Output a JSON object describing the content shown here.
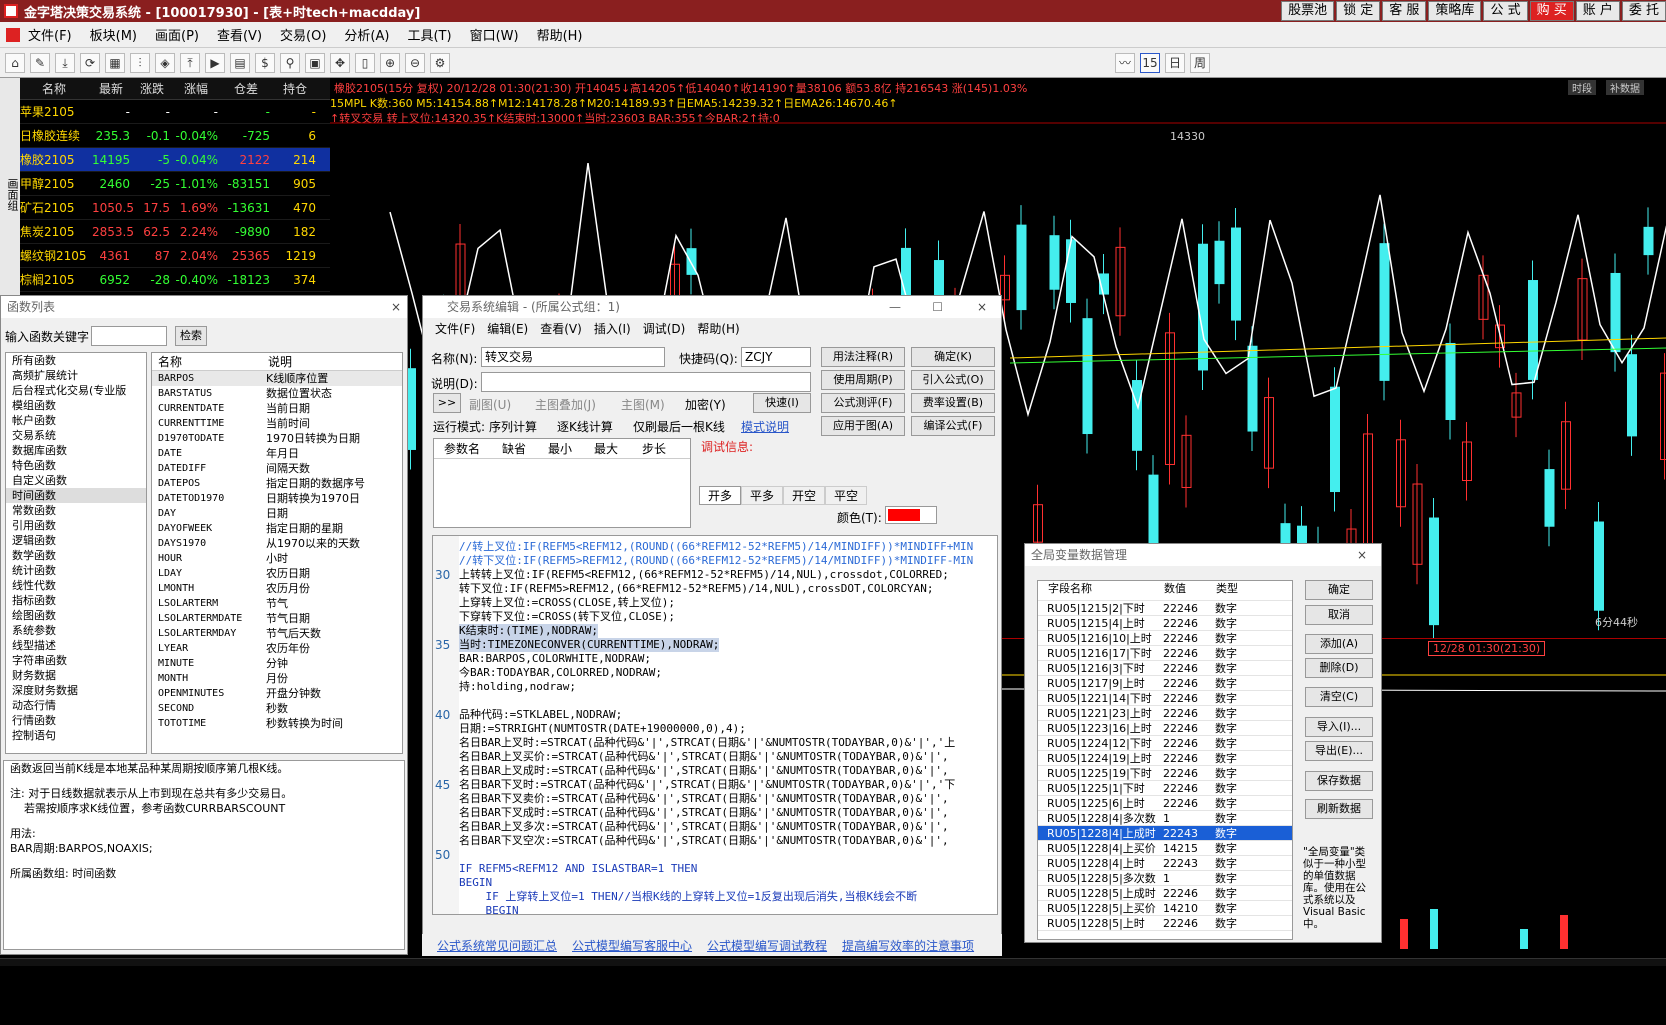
{
  "app": {
    "title": "金字塔决策交易系统 - [100017930] - [表+时tech+macdday]",
    "title_buttons": [
      "股票池",
      "锁 定",
      "客 服",
      "策略库",
      "公 式",
      "购 买",
      "账 户",
      "委 托"
    ]
  },
  "menu": [
    "文件(F)",
    "板块(M)",
    "画面(P)",
    "查看(V)",
    "交易(O)",
    "分析(A)",
    "工具(T)",
    "窗口(W)",
    "帮助(H)"
  ],
  "sidebar_strip": "画面组",
  "toolbar": {
    "period": "15",
    "day": "日",
    "week": "周"
  },
  "quote": {
    "headers": [
      "名称",
      "最新",
      "涨跌",
      "涨幅",
      "仓差",
      "持仓"
    ],
    "rows": [
      {
        "name": "苹果2105",
        "last": "-",
        "chg": "-",
        "pct": "-",
        "oi": "-",
        "pos": "-"
      },
      {
        "name": "日橡胶连续",
        "last": "235.3",
        "chg": "-0.1",
        "pct": "-0.04%",
        "oi": "-725",
        "pos": "6"
      },
      {
        "name": "橡胶2105",
        "last": "14195",
        "chg": "-5",
        "pct": "-0.04%",
        "oi": "2122",
        "pos": "214"
      },
      {
        "name": "甲醇2105",
        "last": "2460",
        "chg": "-25",
        "pct": "-1.01%",
        "oi": "-83151",
        "pos": "905"
      },
      {
        "name": "矿石2105",
        "last": "1050.5",
        "chg": "17.5",
        "pct": "1.69%",
        "oi": "-13631",
        "pos": "470"
      },
      {
        "name": "焦炭2105",
        "last": "2853.5",
        "chg": "62.5",
        "pct": "2.24%",
        "oi": "-9890",
        "pos": "182"
      },
      {
        "name": "螺纹钢2105",
        "last": "4361",
        "chg": "87",
        "pct": "2.04%",
        "oi": "25365",
        "pos": "1219"
      },
      {
        "name": "棕榈2105",
        "last": "6952",
        "chg": "-28",
        "pct": "-0.40%",
        "oi": "-18123",
        "pos": "374"
      }
    ]
  },
  "chart": {
    "line1": "橡胶2105(15分 复权) 20/12/28 01:30(21:30) 开14045↓高14205↑低14040↑收14190↑量38106 额53.8亿 持216543 涨(145)1.03%",
    "line2": "15MPL K数:360 M5:14154.88↑M12:14178.28↑M20:14189.93↑日EMA5:14239.32↑日EMA26:14670.46↑",
    "line3": "↑转叉交易 转上叉位:14320.35↑K结束时:13000↑当时:23603 BAR:355↑今BAR:2↑持:0",
    "price_label": "14330",
    "right_tag1": "时段",
    "right_tag2": "补数据",
    "time_remaining": "6分44秒",
    "cursor_time": "12/28 01:30(21:30)"
  },
  "fnlist": {
    "title": "函数列表",
    "search_label": "输入函数关键字",
    "search_btn": "检索",
    "categories": [
      "所有函数",
      "高频扩展统计",
      "后台程式化交易(专业版",
      "模组函数",
      "帐户函数",
      "交易系统",
      "数据库函数",
      "特色函数",
      "自定义函数",
      "时间函数",
      "常数函数",
      "引用函数",
      "逻辑函数",
      "数学函数",
      "统计函数",
      "线性代数",
      "指标函数",
      "绘图函数",
      "系统参数",
      "线型描述",
      "字符串函数",
      "财务数据",
      "深度财务数据",
      "动态行情",
      "行情函数",
      "控制语句"
    ],
    "col_name": "名称",
    "col_desc": "说明",
    "funcs": [
      [
        "BARPOS",
        "K线顺序位置"
      ],
      [
        "BARSTATUS",
        "数据位置状态"
      ],
      [
        "CURRENTDATE",
        "当前日期"
      ],
      [
        "CURRENTTIME",
        "当前时间"
      ],
      [
        "D1970TODATE",
        "1970日转换为日期"
      ],
      [
        "DATE",
        "年月日"
      ],
      [
        "DATEDIFF",
        "间隔天数"
      ],
      [
        "DATEPOS",
        "指定日期的数据序号"
      ],
      [
        "DATETOD1970",
        "日期转换为1970日"
      ],
      [
        "DAY",
        "日期"
      ],
      [
        "DAYOFWEEK",
        "指定日期的星期"
      ],
      [
        "DAYS1970",
        "从1970以来的天数"
      ],
      [
        "HOUR",
        "小时"
      ],
      [
        "LDAY",
        "农历日期"
      ],
      [
        "LMONTH",
        "农历月份"
      ],
      [
        "LSOLARTERM",
        "节气"
      ],
      [
        "LSOLARTERMDATE",
        "节气日期"
      ],
      [
        "LSOLARTERMDAY",
        "节气后天数"
      ],
      [
        "LYEAR",
        "农历年份"
      ],
      [
        "MINUTE",
        "分钟"
      ],
      [
        "MONTH",
        "月份"
      ],
      [
        "OPENMINUTES",
        "开盘分钟数"
      ],
      [
        "SECOND",
        "秒数"
      ],
      [
        "TOTOTIME",
        "秒数转换为时间"
      ]
    ],
    "help": [
      "函数返回当前K线是本地某品种某周期按顺序第几根K线。",
      "注: 对于日线数据就表示从上市到现在总共有多少交易日。",
      "    若需按顺序求K线位置，参考函数CURRBARSCOUNT",
      "用法:",
      "BAR周期:BARPOS,NOAXIS;",
      "所属函数组: 时间函数"
    ]
  },
  "editor": {
    "title": "交易系统编辑 - (所属公式组：1)",
    "menu": [
      "文件(F)",
      "编辑(E)",
      "查看(V)",
      "插入(I)",
      "调试(D)",
      "帮助(H)"
    ],
    "name_label": "名称(N):",
    "name_value": "转叉交易",
    "shortcut_label": "快捷码(Q):",
    "shortcut_value": "ZCJY",
    "desc_label": "说明(D):",
    "btns": [
      "用法注释(R)",
      "确定(K)",
      "使用周期(P)",
      "引入公式(O)",
      "公式测评(F)",
      "费率设置(B)",
      "应用于图(A)",
      "编译公式(F)"
    ],
    "opt_sub": "副图(U)",
    "opt_main_overlay": "主图叠加(J)",
    "opt_main": "主图(M)",
    "opt_encrypt": "加密(Y)",
    "btn_fast": "快速(I)",
    "btn_more": ">>",
    "run_label": "运行模式:",
    "run_seq": "序列计算",
    "run_bar": "逐K线计算",
    "run_last": "仅刷最后一根K线",
    "run_link": "模式说明",
    "param_cols": [
      "参数名",
      "缺省",
      "最小",
      "最大",
      "步长"
    ],
    "debug_label": "调试信息:",
    "tabs": [
      "开多",
      "平多",
      "开空",
      "平空"
    ],
    "color_label": "颜色(T):",
    "code": [
      {
        "n": "",
        "t": "//转上叉位:IF(REFM5<REFM12,(ROUND((66*REFM12-52*REFM5)/14/MINDIFF))*MINDIFF+MIN",
        "c": "#2b6ad6"
      },
      {
        "n": "",
        "t": "//转下叉位:IF(REFM5>REFM12,(ROUND((66*REFM12-52*REFM5)/14/MINDIFF))*MINDIFF-MIN",
        "c": "#2b6ad6"
      },
      {
        "n": "30",
        "t": "上转转上叉位:IF(REFM5<REFM12,(66*REFM12-52*REFM5)/14,NUL),crossdot,COLORRED;",
        "c": "#000"
      },
      {
        "n": "",
        "t": "转下叉位:IF(REFM5>REFM12,(66*REFM12-52*REFM5)/14,NUL),crossDOT,COLORCYAN;",
        "c": "#000"
      },
      {
        "n": "",
        "t": "上穿转上叉位:=CROSS(CLOSE,转上叉位);",
        "c": "#000"
      },
      {
        "n": "",
        "t": "下穿转下叉位:=CROSS(转下叉位,CLOSE);",
        "c": "#000"
      },
      {
        "n": "",
        "t": "K结束时:(TIME),NODRAW;",
        "c": "#000"
      },
      {
        "n": "35",
        "t": "当时:TIMEZONECONVER(CURRENTTIME),NODRAW;",
        "c": "#000"
      },
      {
        "n": "",
        "t": "BAR:BARPOS,COLORWHITE,NODRAW;",
        "c": "#000"
      },
      {
        "n": "",
        "t": "今BAR:TODAYBAR,COLORRED,NODRAW;",
        "c": "#000"
      },
      {
        "n": "",
        "t": "持:holding,nodraw;",
        "c": "#000"
      },
      {
        "n": "",
        "t": "",
        "c": "#000"
      },
      {
        "n": "40",
        "t": "品种代码:=STKLABEL,NODRAW;",
        "c": "#000"
      },
      {
        "n": "",
        "t": "日期:=STRRIGHT(NUMTOSTR(DATE+19000000,0),4);",
        "c": "#000"
      },
      {
        "n": "",
        "t": "名日BAR上叉时:=STRCAT(品种代码&'|',STRCAT(日期&'|'&NUMTOSTR(TODAYBAR,0)&'|','上",
        "c": "#000"
      },
      {
        "n": "",
        "t": "名日BAR上叉买价:=STRCAT(品种代码&'|',STRCAT(日期&'|'&NUMTOSTR(TODAYBAR,0)&'|',",
        "c": "#000"
      },
      {
        "n": "",
        "t": "名日BAR上叉成时:=STRCAT(品种代码&'|',STRCAT(日期&'|'&NUMTOSTR(TODAYBAR,0)&'|',",
        "c": "#000"
      },
      {
        "n": "45",
        "t": "名日BAR下叉时:=STRCAT(品种代码&'|',STRCAT(日期&'|'&NUMTOSTR(TODAYBAR,0)&'|','下",
        "c": "#000"
      },
      {
        "n": "",
        "t": "名日BAR下叉卖价:=STRCAT(品种代码&'|',STRCAT(日期&'|'&NUMTOSTR(TODAYBAR,0)&'|',",
        "c": "#000"
      },
      {
        "n": "",
        "t": "名日BAR下叉成时:=STRCAT(品种代码&'|',STRCAT(日期&'|'&NUMTOSTR(TODAYBAR,0)&'|',",
        "c": "#000"
      },
      {
        "n": "",
        "t": "名日BAR上叉多次:=STRCAT(品种代码&'|',STRCAT(日期&'|'&NUMTOSTR(TODAYBAR,0)&'|',",
        "c": "#000"
      },
      {
        "n": "",
        "t": "名日BAR下叉空次:=STRCAT(品种代码&'|',STRCAT(日期&'|'&NUMTOSTR(TODAYBAR,0)&'|',",
        "c": "#000"
      },
      {
        "n": "50",
        "t": "",
        "c": "#000"
      },
      {
        "n": "",
        "t": "IF REFM5<REFM12 AND ISLASTBAR=1 THEN",
        "c": "#1a3ab8"
      },
      {
        "n": "",
        "t": "BEGIN",
        "c": "#1a3ab8"
      },
      {
        "n": "",
        "t": "    IF 上穿转上叉位=1 THEN//当根K线的上穿转上叉位=1反复出现后消失,当根K线会不断",
        "c": "#1a3ab8"
      },
      {
        "n": "",
        "t": "    BEGIN",
        "c": "#1a3ab8"
      }
    ],
    "links": [
      "公式系统常见问题汇总",
      "公式模型编写客服中心",
      "公式模型编写调试教程",
      "提高编写效率的注意事项"
    ]
  },
  "gv": {
    "title": "全局变量数据管理",
    "cols": [
      "字段名称",
      "数值",
      "类型"
    ],
    "rows": [
      [
        "RU05|1215|2|下时",
        "22246",
        "数字"
      ],
      [
        "RU05|1215|4|上时",
        "22246",
        "数字"
      ],
      [
        "RU05|1216|10|上时",
        "22246",
        "数字"
      ],
      [
        "RU05|1216|17|下时",
        "22246",
        "数字"
      ],
      [
        "RU05|1216|3|下时",
        "22246",
        "数字"
      ],
      [
        "RU05|1217|9|上时",
        "22246",
        "数字"
      ],
      [
        "RU05|1221|14|下时",
        "22246",
        "数字"
      ],
      [
        "RU05|1221|23|上时",
        "22246",
        "数字"
      ],
      [
        "RU05|1223|16|上时",
        "22246",
        "数字"
      ],
      [
        "RU05|1224|12|下时",
        "22246",
        "数字"
      ],
      [
        "RU05|1224|19|上时",
        "22246",
        "数字"
      ],
      [
        "RU05|1225|19|下时",
        "22246",
        "数字"
      ],
      [
        "RU05|1225|1|下时",
        "22246",
        "数字"
      ],
      [
        "RU05|1225|6|上时",
        "22246",
        "数字"
      ],
      [
        "RU05|1228|4|多次数",
        "1",
        "数字"
      ],
      [
        "RU05|1228|4|上成时",
        "22243",
        "数字"
      ],
      [
        "RU05|1228|4|上买价",
        "14215",
        "数字"
      ],
      [
        "RU05|1228|4|上时",
        "22243",
        "数字"
      ],
      [
        "RU05|1228|5|多次数",
        "1",
        "数字"
      ],
      [
        "RU05|1228|5|上成时",
        "22246",
        "数字"
      ],
      [
        "RU05|1228|5|上买价",
        "14210",
        "数字"
      ],
      [
        "RU05|1228|5|上时",
        "22246",
        "数字"
      ]
    ],
    "btns": [
      "确定",
      "取消",
      "添加(A)",
      "删除(D)",
      "清空(C)",
      "导入(I)...",
      "导出(E)...",
      "保存数据",
      "刷新数据"
    ],
    "note": "\"全局变量\"类似于一种小型的单值数据库。使用在公式系统以及Visual Basic中。"
  }
}
